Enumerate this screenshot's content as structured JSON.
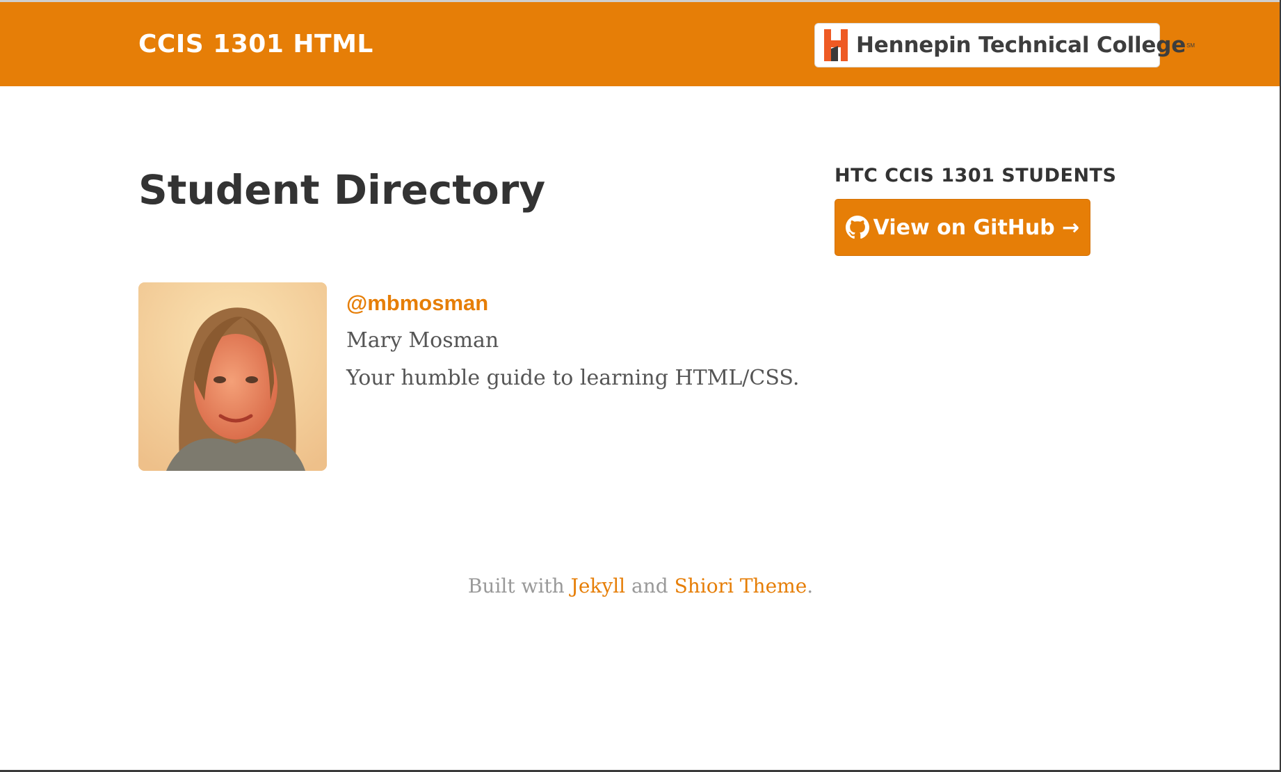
{
  "header": {
    "site_title": "CCIS 1301 HTML",
    "college_logo": {
      "name": "Hennepin Technical College",
      "mark": "SM"
    }
  },
  "main": {
    "page_title": "Student Directory",
    "students": [
      {
        "handle": "@mbmosman",
        "name": "Mary Mosman",
        "bio": "Your humble guide to learning HTML/CSS."
      }
    ]
  },
  "sidebar": {
    "heading": "HTC CCIS 1301 STUDENTS",
    "github_button_label": "View on GitHub →",
    "github_icon": "github-icon"
  },
  "footer": {
    "prefix": "Built with",
    "link1": "Jekyll",
    "middle": "and",
    "link2": "Shiori Theme",
    "suffix": "."
  },
  "colors": {
    "accent": "#e67e07",
    "heading": "#333333",
    "body_text": "#555555",
    "footer_text": "#999999",
    "background": "#ffffff"
  }
}
